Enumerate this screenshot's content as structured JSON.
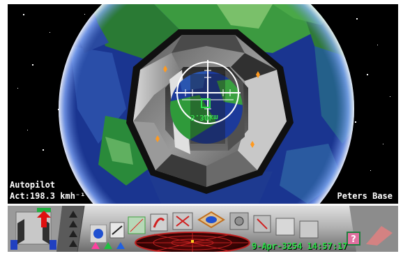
{
  "hud": {
    "mode": "Autopilot",
    "speed": "Act:198.3 kmh⁻¹",
    "target": "Peters Base",
    "range": "5.30km"
  },
  "console": {
    "datetime": "9-Apr-3254 14:57:17"
  },
  "icons": {
    "left_arrow": "red-arrow-icon",
    "help": "question-mark-icon"
  },
  "colors": {
    "space": "#000000",
    "ocean": "#1a3a9a",
    "land": "#2f8a3a",
    "station_hull": "#8a8a8a",
    "crosshair": "#ffffff",
    "hud_green": "#2ee04a",
    "scanner_red": "#c02020",
    "marker_orange": "#ff9a20"
  }
}
